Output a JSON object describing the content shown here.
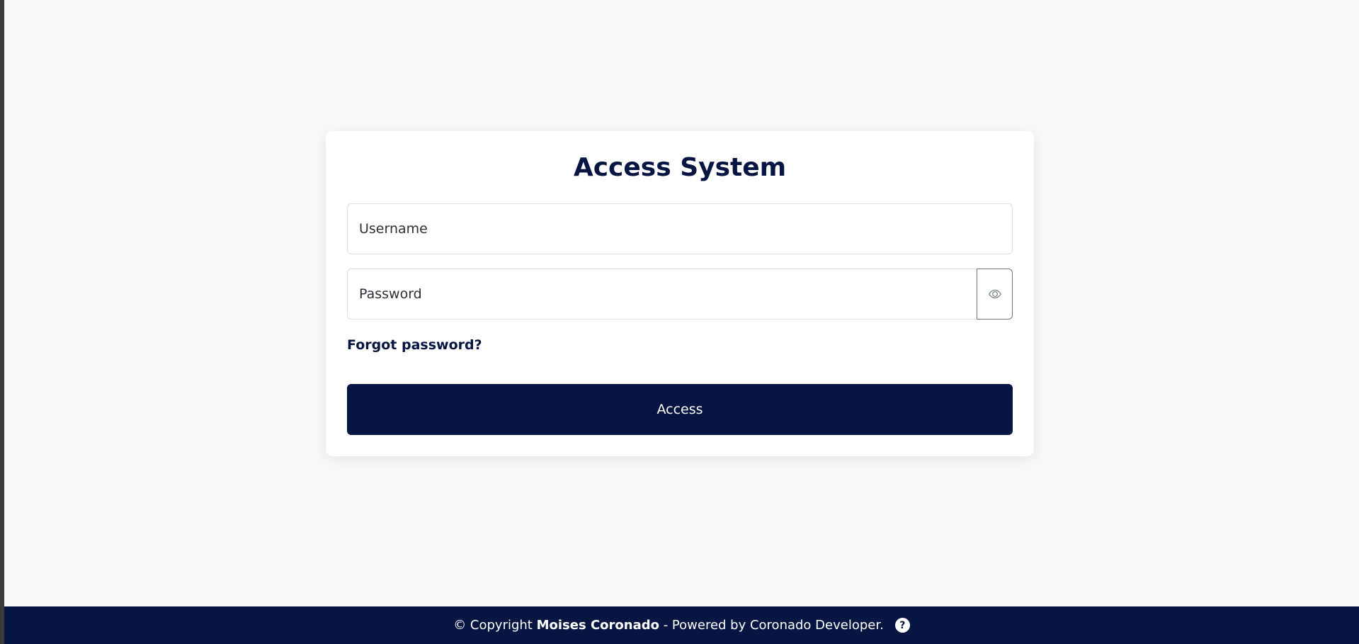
{
  "login": {
    "title": "Access System",
    "username_placeholder": "Username",
    "password_placeholder": "Password",
    "forgot_link": "Forgot password?",
    "submit_label": "Access"
  },
  "footer": {
    "prefix": "© Copyright ",
    "name": "Moises Coronado",
    "suffix": " - Powered by Coronado Developer.",
    "help_glyph": "?"
  },
  "icons": {
    "password_toggle": "eye-icon",
    "help": "help-circle-icon"
  },
  "colors": {
    "primary": "#061541",
    "background": "#f7f8fa",
    "card": "#ffffff"
  }
}
